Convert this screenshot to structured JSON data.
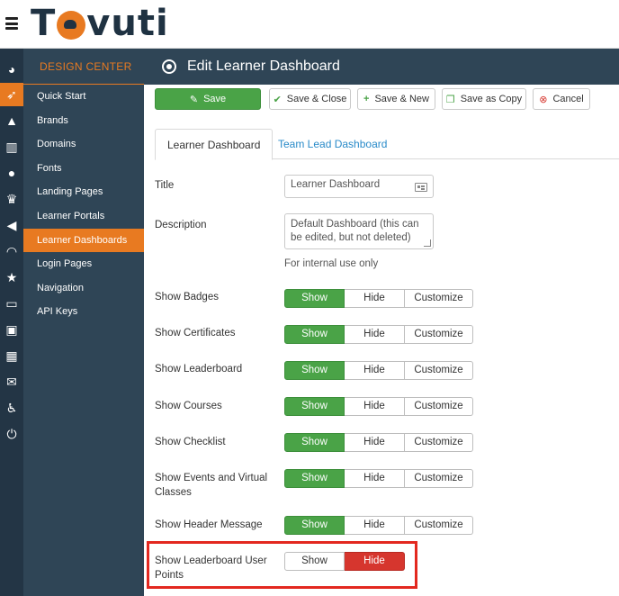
{
  "brand": {
    "logo_text_left": "T",
    "logo_text_right": "vuti",
    "accent": "#e87a21",
    "dark": "#2f4556"
  },
  "rail": {
    "icons": [
      "dashboard-icon",
      "rocket-icon",
      "graduation-cap-icon",
      "bar-chart-icon",
      "users-icon",
      "trophy-icon",
      "megaphone-icon",
      "rss-icon",
      "star-icon",
      "credit-card-icon",
      "id-badge-icon",
      "calendar-icon",
      "comments-icon",
      "accessibility-icon",
      "power-icon"
    ]
  },
  "sidebar": {
    "heading": "DESIGN CENTER",
    "items": [
      {
        "label": "Quick Start"
      },
      {
        "label": "Brands"
      },
      {
        "label": "Domains"
      },
      {
        "label": "Fonts"
      },
      {
        "label": "Landing Pages"
      },
      {
        "label": "Learner Portals"
      },
      {
        "label": "Learner Dashboards",
        "active": true
      },
      {
        "label": "Login Pages"
      },
      {
        "label": "Navigation"
      },
      {
        "label": "API Keys"
      }
    ]
  },
  "header": {
    "title": "Edit Learner Dashboard"
  },
  "toolbar": {
    "save": "Save",
    "save_close": "Save & Close",
    "save_new": "Save & New",
    "save_copy": "Save as Copy",
    "cancel": "Cancel"
  },
  "tabs": {
    "learner": "Learner Dashboard",
    "team_lead": "Team Lead Dashboard"
  },
  "form": {
    "title_label": "Title",
    "title_value": "Learner Dashboard",
    "description_label": "Description",
    "description_value": "Default Dashboard (this can be edited, but not deleted)",
    "description_help": "For internal use only",
    "show": "Show",
    "hide": "Hide",
    "customize": "Customize",
    "rows": [
      {
        "label": "Show Badges",
        "selected": "Show"
      },
      {
        "label": "Show Certificates",
        "selected": "Show"
      },
      {
        "label": "Show Leaderboard",
        "selected": "Show"
      },
      {
        "label": "Show Courses",
        "selected": "Show"
      },
      {
        "label": "Show Checklist",
        "selected": "Show"
      },
      {
        "label": "Show Events and Virtual Classes",
        "selected": "Show"
      },
      {
        "label": "Show Header Message",
        "selected": "Show"
      },
      {
        "label": "Show Leaderboard User Points",
        "selected": "Hide"
      }
    ]
  }
}
